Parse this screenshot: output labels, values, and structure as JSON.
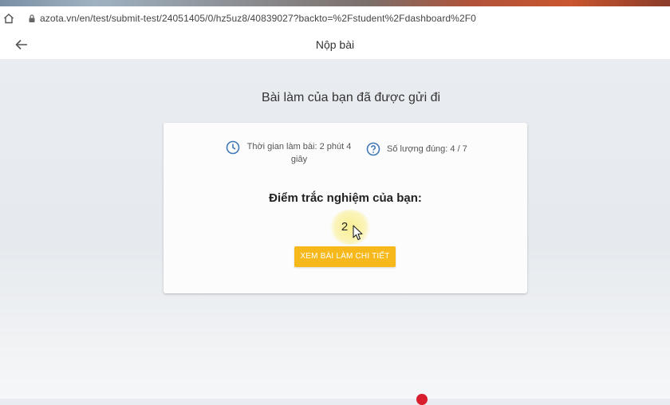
{
  "browser": {
    "url": "azota.vn/en/test/submit-test/24051405/0/hz5uz8/40839027?backto=%2Fstudent%2Fdashboard%2F0"
  },
  "header": {
    "title": "Nộp bài"
  },
  "main": {
    "heading": "Bài làm của bạn đã được gửi đi",
    "time_label": "Thời gian làm bài: 2 phút 4 giây",
    "correct_label": "Số lượng đúng: 4 / 7",
    "score_label": "Điểm trắc nghiệm của bạn:",
    "score_value": "2",
    "detail_button": "XEM BÀI LÀM CHI TIẾT"
  },
  "icons": {
    "home": "home-icon",
    "lock": "lock-icon",
    "back": "arrow-left-icon",
    "clock": "clock-icon",
    "question": "help-circle-icon",
    "cursor": "mouse-cursor-icon"
  },
  "colors": {
    "accent": "#f6b81a",
    "icon_blue": "#3f78b5",
    "background": "#e9edf1"
  }
}
